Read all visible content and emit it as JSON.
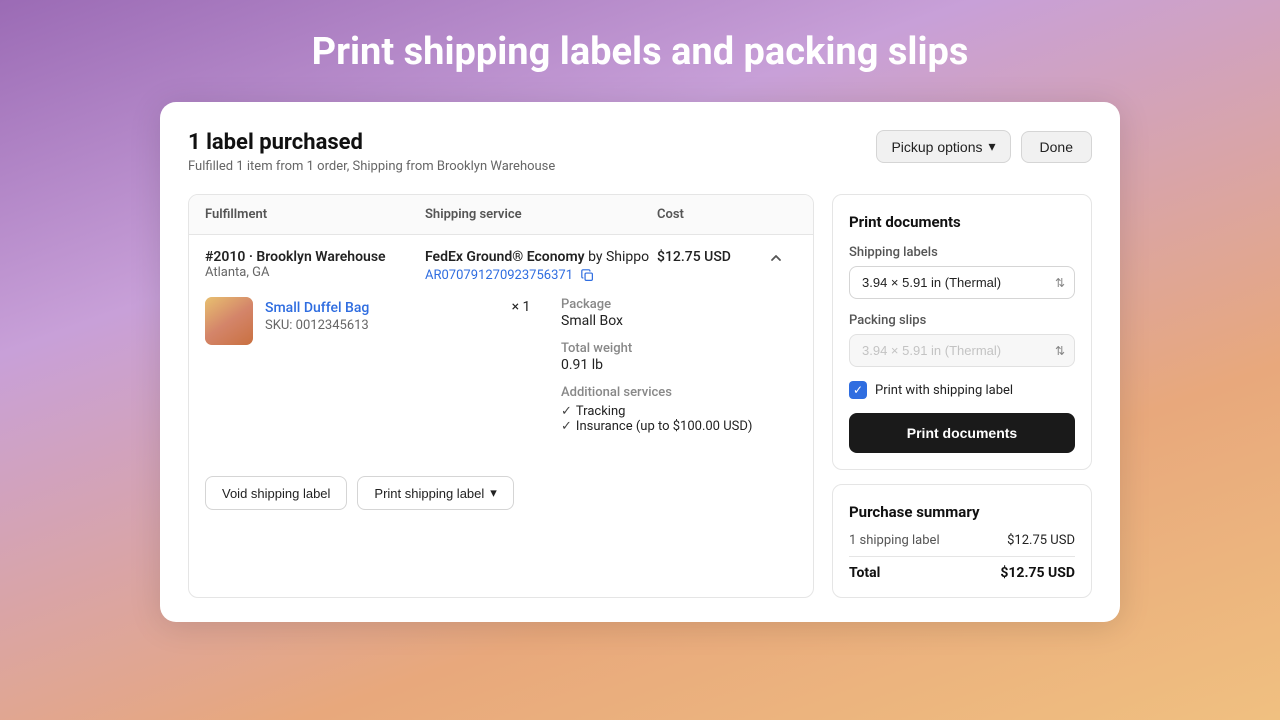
{
  "page": {
    "title": "Print shipping labels and packing slips",
    "background": "purple-orange-gradient"
  },
  "card": {
    "header": {
      "title": "1 label purchased",
      "subtitle": "Fulfilled 1 item from 1 order, Shipping from Brooklyn Warehouse",
      "pickup_button": "Pickup options",
      "done_button": "Done"
    },
    "table": {
      "columns": [
        "Fulfillment",
        "Shipping service",
        "Cost",
        ""
      ]
    },
    "fulfillment": {
      "id": "#2010 · Brooklyn Warehouse",
      "location": "Atlanta, GA",
      "service_name": "FedEx Ground® Economy",
      "service_provider": "by Shippo",
      "tracking_number": "AR070791270923756371",
      "cost": "$12.75 USD",
      "item": {
        "name": "Small Duffel Bag",
        "sku": "SKU: 0012345613",
        "qty": "× 1"
      },
      "package": {
        "label": "Package",
        "value": "Small Box"
      },
      "weight": {
        "label": "Total weight",
        "value": "0.91 lb"
      },
      "additional_services": {
        "label": "Additional services",
        "items": [
          "Tracking",
          "Insurance (up to $100.00 USD)"
        ]
      }
    },
    "action_buttons": {
      "void_label": "Void shipping label",
      "print_label": "Print shipping label"
    }
  },
  "print_docs_panel": {
    "title": "Print documents",
    "shipping_labels_label": "Shipping labels",
    "shipping_labels_option": "3.94 × 5.91 in (Thermal)",
    "packing_slips_label": "Packing slips",
    "packing_slips_option": "3.94 × 5.91 in (Thermal)",
    "checkbox_label": "Print with shipping label",
    "print_button": "Print documents"
  },
  "purchase_summary": {
    "title": "Purchase summary",
    "rows": [
      {
        "label": "1 shipping label",
        "value": "$12.75 USD"
      }
    ],
    "total_label": "Total",
    "total_value": "$12.75 USD"
  }
}
